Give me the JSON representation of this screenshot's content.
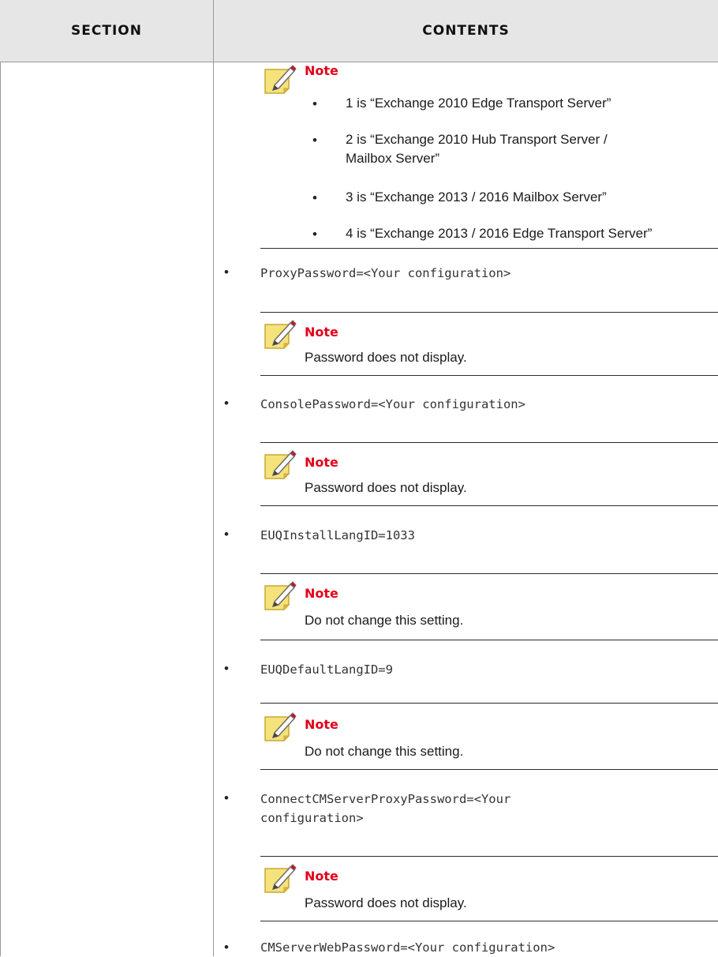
{
  "header": {
    "section": "SECTION",
    "contents": "CONTENTS"
  },
  "note_label": "Note",
  "first_note_items": [
    "1 is “Exchange 2010 Edge Transport Server”",
    "2 is “Exchange 2010 Hub Transport Server /",
    "Mailbox Server”",
    "3 is “Exchange 2013 / 2016 Mailbox Server”",
    "4 is “Exchange 2013 / 2016 Edge Transport Server”"
  ],
  "bullet_char": "•",
  "settings": [
    {
      "code": "ProxyPassword=<Your configuration>",
      "note": "Password does not display."
    },
    {
      "code": "ConsolePassword=<Your configuration>",
      "note": "Password does not display."
    },
    {
      "code": "EUQInstallLangID=1033",
      "note": "Do not change this setting."
    },
    {
      "code": "EUQDefaultLangID=9",
      "note": "Do not change this setting."
    },
    {
      "code": "ConnectCMServerProxyPassword=<Your\nconfiguration>",
      "note": "Password does not display."
    },
    {
      "code": "CMServerWebPassword=<Your configuration>"
    }
  ]
}
